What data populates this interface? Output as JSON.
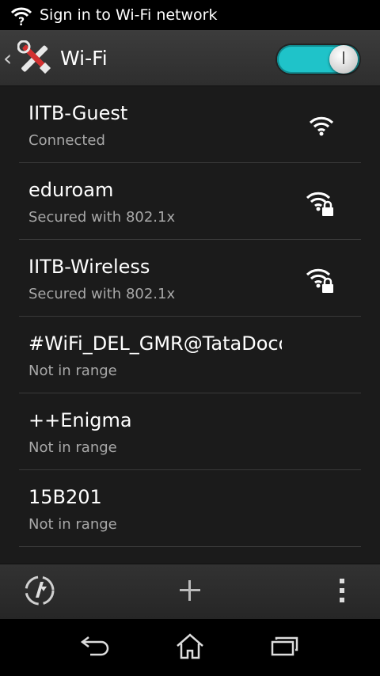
{
  "status_bar": {
    "notification_text": "Sign in to Wi-Fi network",
    "notification_icon": "wifi-question-icon"
  },
  "action_bar": {
    "title": "Wi-Fi",
    "toggle_state": "on",
    "accent_color": "#1fc3c9"
  },
  "networks": [
    {
      "name": "IITB-Guest",
      "status": "Connected",
      "signal_icon": "wifi-signal-icon"
    },
    {
      "name": "eduroam",
      "status": "Secured with 802.1x",
      "signal_icon": "wifi-locked-icon"
    },
    {
      "name": "IITB-Wireless",
      "status": "Secured with 802.1x",
      "signal_icon": "wifi-locked-icon"
    },
    {
      "name": "#WiFi_DEL_GMR@TataDocomo",
      "status": "Not in range",
      "signal_icon": ""
    },
    {
      "name": "++Enigma",
      "status": "Not in range",
      "signal_icon": ""
    },
    {
      "name": "15B201",
      "status": "Not in range",
      "signal_icon": ""
    }
  ],
  "bottom_bar": {
    "wps_icon": "wps-icon",
    "add_icon": "add-icon",
    "overflow_icon": "overflow-menu-icon"
  },
  "nav_bar": {
    "back_icon": "back-icon",
    "home_icon": "home-icon",
    "recents_icon": "recents-icon"
  }
}
